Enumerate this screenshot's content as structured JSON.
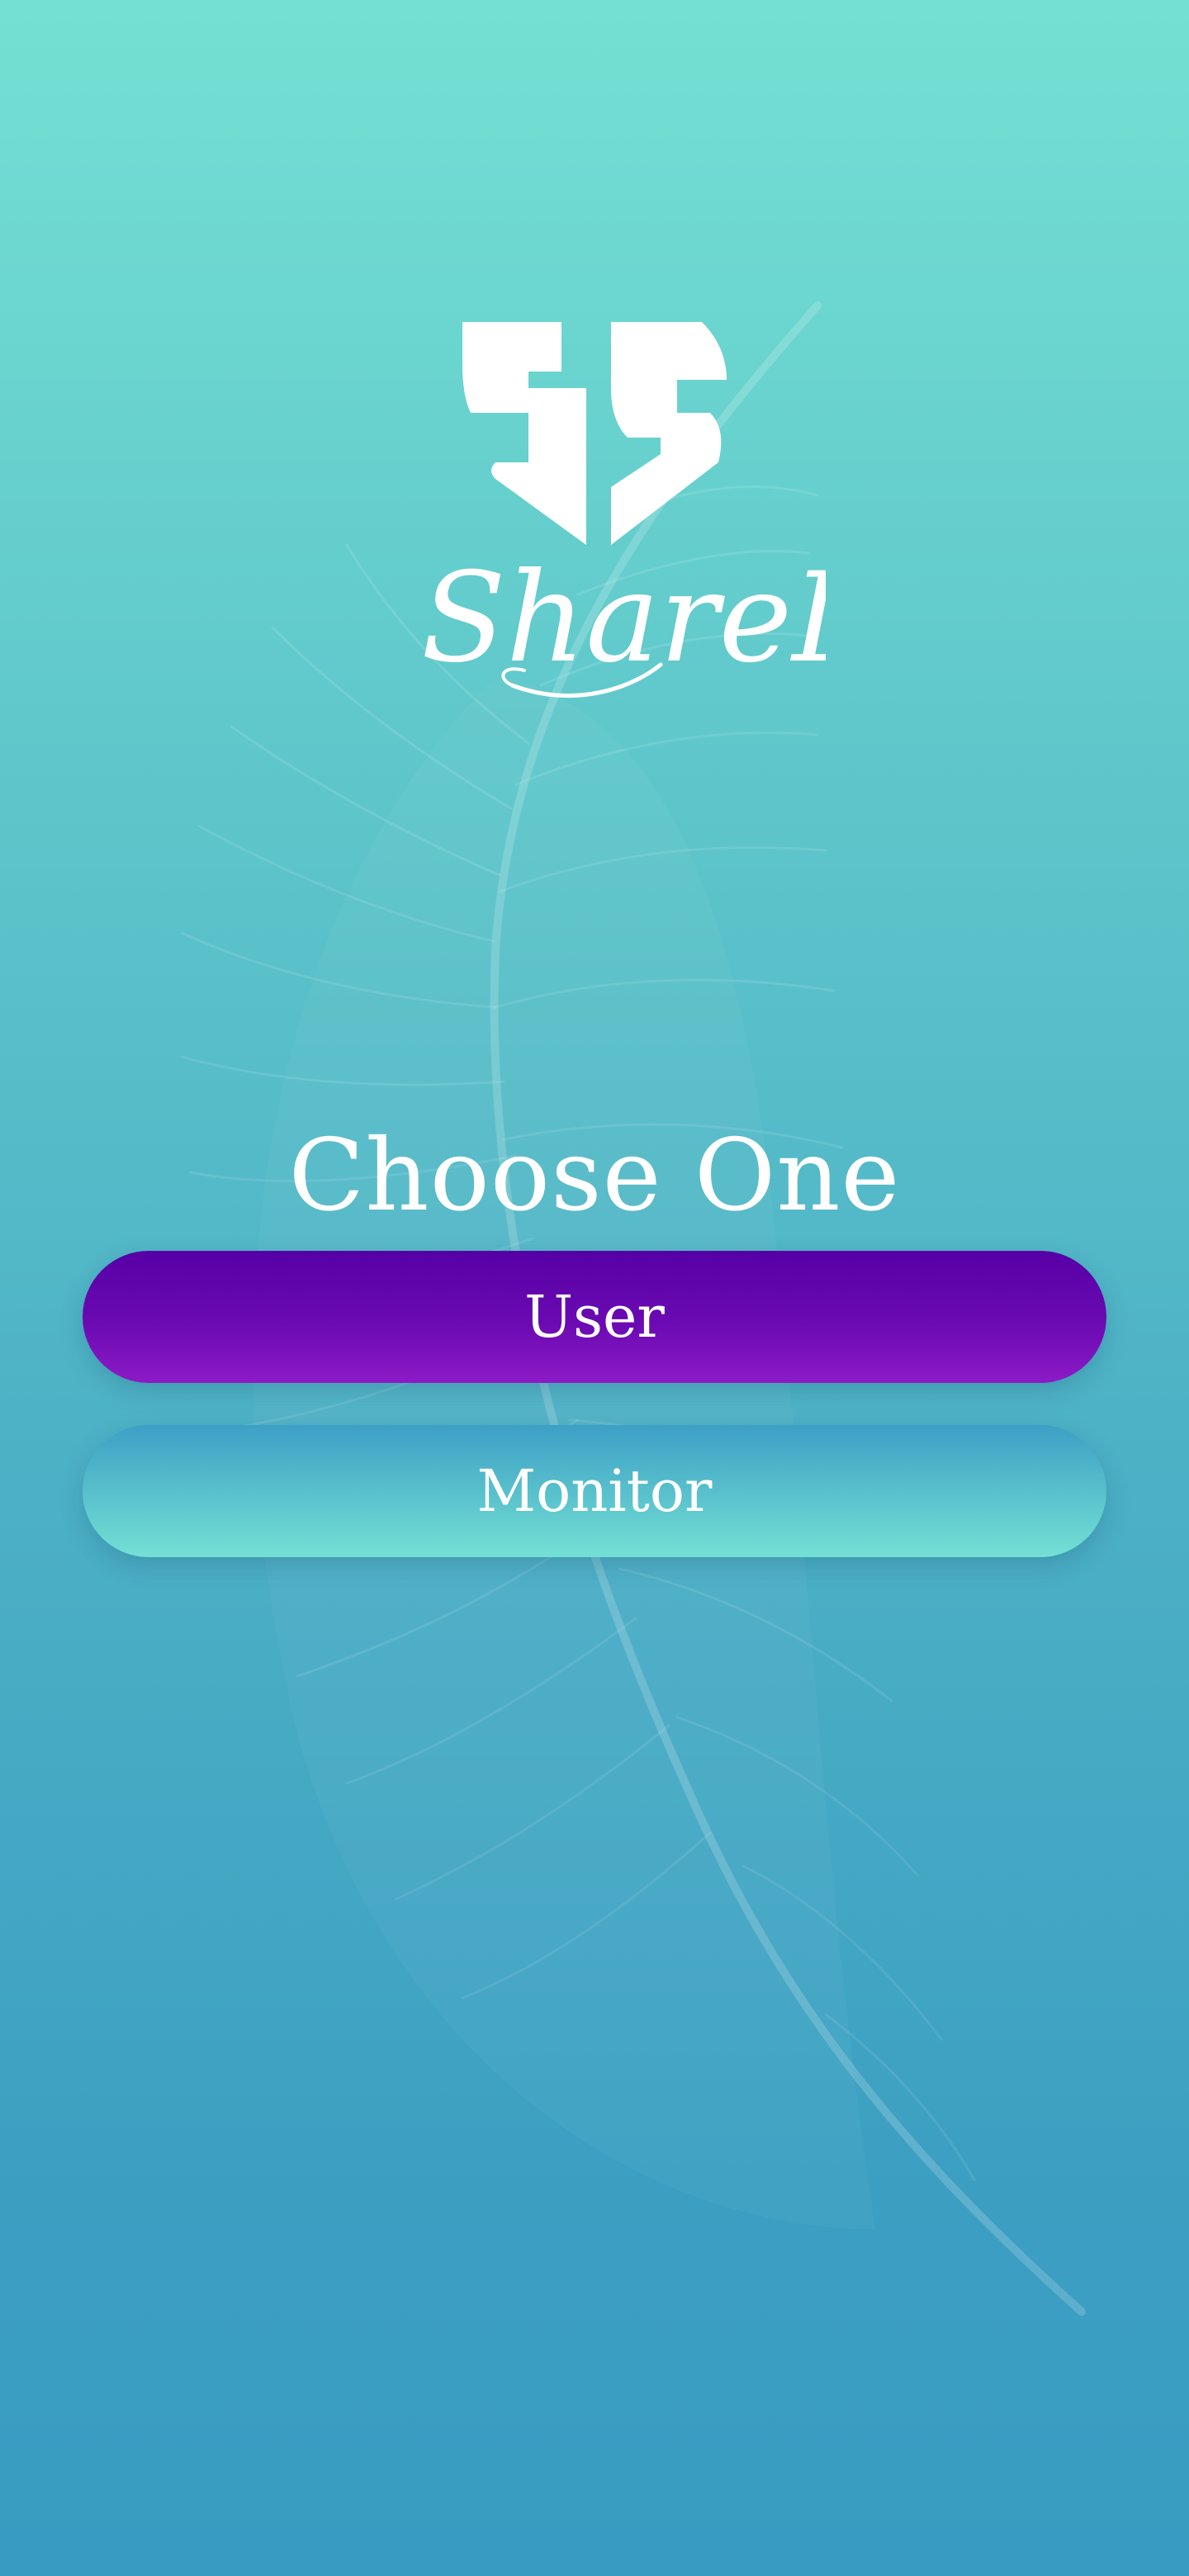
{
  "app": {
    "logo_mark": "SS",
    "logo_wordmark": "ShareIt"
  },
  "main": {
    "title": "Choose One",
    "options": [
      {
        "label": "User"
      },
      {
        "label": "Monitor"
      }
    ]
  },
  "icons": {
    "logo": "shareit-logo-icon",
    "background": "feather-icon"
  },
  "colors": {
    "background_top": "#74e0d3",
    "background_bottom": "#389bc1",
    "user_button_top": "#5600a6",
    "user_button_bottom": "#8c1bc7",
    "monitor_button_top": "#3d9fc6",
    "monitor_button_bottom": "#74e0d4",
    "text": "#ffffff"
  }
}
